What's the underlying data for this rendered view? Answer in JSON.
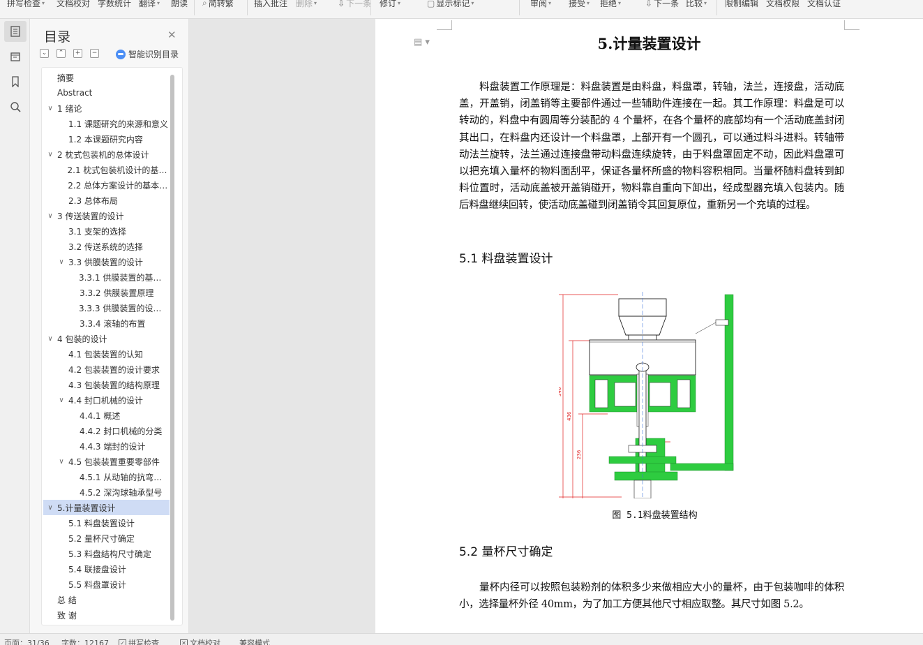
{
  "toolbar": {
    "items": [
      {
        "label": "拼写检查",
        "caret": true
      },
      {
        "label": "文档校对",
        "caret": false
      },
      {
        "label": "字数统计",
        "caret": false
      },
      {
        "label": "翻译",
        "caret": true
      },
      {
        "label": "朗读",
        "caret": false
      },
      {
        "label": "简转繁",
        "caret": false
      },
      {
        "label": "插入批注",
        "caret": false
      },
      {
        "label": "删除",
        "caret": true
      },
      {
        "label": "下一条",
        "caret": false
      },
      {
        "label": "修订",
        "caret": true
      },
      {
        "label": "显示标记",
        "caret": true
      },
      {
        "label": "审阅",
        "caret": true
      },
      {
        "label": "接受",
        "caret": true
      },
      {
        "label": "拒绝",
        "caret": true
      },
      {
        "label": "下一条",
        "caret": false
      },
      {
        "label": "比较",
        "caret": true
      },
      {
        "label": "限制编辑",
        "caret": false
      },
      {
        "label": "文档权限",
        "caret": false
      },
      {
        "label": "文档认证",
        "caret": false
      }
    ]
  },
  "toc": {
    "title": "目录",
    "smart_label": "智能识别目录",
    "items": [
      {
        "label": "摘要",
        "level": 0,
        "chevron": false
      },
      {
        "label": "Abstract",
        "level": 0,
        "chevron": false
      },
      {
        "label": "1 绪论",
        "level": 0,
        "chevron": true
      },
      {
        "label": "1.1 课题研究的来源和意义",
        "level": 1,
        "chevron": false
      },
      {
        "label": "1.2 本课题研究内容",
        "level": 1,
        "chevron": false
      },
      {
        "label": "2 枕式包装机的总体设计",
        "level": 0,
        "chevron": true
      },
      {
        "label": "2.1 枕式包装机设计的基本要求",
        "level": 1,
        "chevron": false
      },
      {
        "label": "2.2 总体方案设计的基本原则",
        "level": 1,
        "chevron": false
      },
      {
        "label": "2.3 总体布局",
        "level": 1,
        "chevron": false
      },
      {
        "label": "3 传送装置的设计",
        "level": 0,
        "chevron": true
      },
      {
        "label": "3.1 支架的选择",
        "level": 1,
        "chevron": false
      },
      {
        "label": "3.2 传送系统的选择",
        "level": 1,
        "chevron": false
      },
      {
        "label": "3.3 供膜装置的设计",
        "level": 1,
        "chevron": true
      },
      {
        "label": "3.3.1 供膜装置的基本要求",
        "level": 2,
        "chevron": false
      },
      {
        "label": "3.3.2 供膜装置原理",
        "level": 2,
        "chevron": false
      },
      {
        "label": "3.3.3 供膜装置的设计计算",
        "level": 2,
        "chevron": false
      },
      {
        "label": "3.3.4 滚轴的布置",
        "level": 2,
        "chevron": false
      },
      {
        "label": "4 包装的设计",
        "level": 0,
        "chevron": true
      },
      {
        "label": "4.1 包装装置的认知",
        "level": 1,
        "chevron": false
      },
      {
        "label": "4.2 包装装置的设计要求",
        "level": 1,
        "chevron": false
      },
      {
        "label": "4.3 包装装置的结构原理",
        "level": 1,
        "chevron": false
      },
      {
        "label": "4.4 封口机械的设计",
        "level": 1,
        "chevron": true
      },
      {
        "label": "4.4.1 概述",
        "level": 2,
        "chevron": false
      },
      {
        "label": "4.4.2 封口机械的分类",
        "level": 2,
        "chevron": false
      },
      {
        "label": "4.4.3 端封的设计",
        "level": 2,
        "chevron": false
      },
      {
        "label": "4.5 包装装置重要零部件",
        "level": 1,
        "chevron": true
      },
      {
        "label": "4.5.1 从动轴的抗弯强度",
        "level": 2,
        "chevron": false
      },
      {
        "label": "4.5.2 深沟球轴承型号",
        "level": 2,
        "chevron": false
      },
      {
        "label": "5.计量装置设计",
        "level": 0,
        "chevron": true,
        "selected": true
      },
      {
        "label": "5.1 料盘装置设计",
        "level": 1,
        "chevron": false
      },
      {
        "label": "5.2 量杯尺寸确定",
        "level": 1,
        "chevron": false
      },
      {
        "label": "5.3 料盘结构尺寸确定",
        "level": 1,
        "chevron": false
      },
      {
        "label": "5.4 联接盘设计",
        "level": 1,
        "chevron": false
      },
      {
        "label": "5.5 料盘罩设计",
        "level": 1,
        "chevron": false
      },
      {
        "label": "总 结",
        "level": 0,
        "chevron": false
      },
      {
        "label": "致 谢",
        "level": 0,
        "chevron": false
      }
    ]
  },
  "doc": {
    "title": "5.计量装置设计",
    "para1": "料盘装置工作原理是：料盘装置是由料盘，料盘罩，转轴，法兰，连接盘，活动底盖，开盖销，闭盖销等主要部件通过一些辅助件连接在一起。其工作原理：料盘是可以转动的，料盘中有圆周等分装配的 4 个量杯，在各个量杯的底部均有一个活动底盖封闭其出口，在料盘内还设计一个料盘罩，上部开有一个圆孔，可以通过料斗进料。转轴带动法兰旋转，法兰通过连接盘带动料盘连续旋转，由于料盘罩固定不动，因此料盘罩可以把充填入量杯的物料面刮平，保证各量杯所盛的物料容积相同。当量杯随料盘转到卸料位置时，活动底盖被开盖销碰开，物料靠自重向下卸出，经成型器充填入包装内。随后料盘继续回转，使活动底盖碰到闭盖销令其回复原位，重新另一个充填的过程。",
    "h1": "5.1 料盘装置设计",
    "figure": {
      "dims": [
        "546",
        "436",
        "236"
      ],
      "caption": "图 5.1料盘装置结构"
    },
    "h2": "5.2 量杯尺寸确定",
    "para2": "量杯内径可以按照包装粉剂的体积多少来做相应大小的量杯，由于包装咖啡的体积小，选择量杯外径 40mm，为了加工方便其他尺寸相应取整。其尺寸如图 5.2。"
  },
  "status": {
    "page": "页面：31/36",
    "words": "字数：12167",
    "spell": "拼写检查",
    "proof": "文档校对",
    "mode": "兼容模式"
  },
  "colors": {
    "selected_toc": "#cfdcf5",
    "drawing_green": "#2ecc40",
    "dimension_red": "#e02020"
  }
}
